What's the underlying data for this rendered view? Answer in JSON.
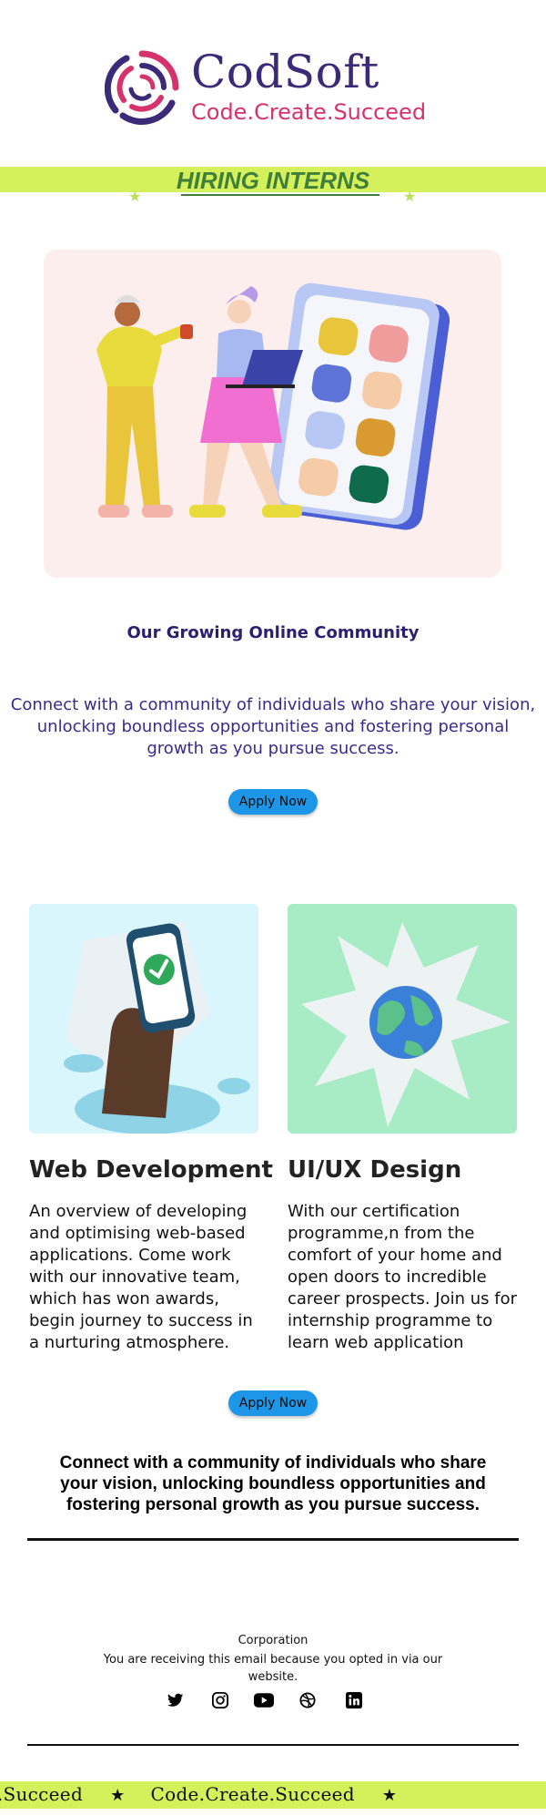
{
  "brand": {
    "name": "CodSoft",
    "tagline": "Code.Create.Succeed",
    "colors": {
      "primary": "#3a2a78",
      "accent": "#d6336c",
      "highlight": "#d4f05a",
      "button": "#1e96e8"
    }
  },
  "hiring": {
    "title": "HIRING INTERNS"
  },
  "hero": {
    "heading": "Our Growing Online Community",
    "text": "Connect with a community of individuals who share your vision, unlocking boundless opportunities and fostering personal growth as you pursue success.",
    "apply_label": "Apply Now"
  },
  "services": [
    {
      "title": "Web Development",
      "description": "An overview of developing and optimising web-based applications.  Come work with our innovative team, which has won awards, begin journey to success in a nurturing atmosphere."
    },
    {
      "title": "UI/UX Design",
      "description": "With our certification programme,n from the comfort of your home and open doors to incredible career prospects. Join us for internship programme to learn web application"
    }
  ],
  "services_apply_label": "Apply Now",
  "statement": "Connect with a community of individuals who share your vision, unlocking boundless opportunities and fostering personal growth as you pursue success.",
  "footer": {
    "corporation": "Corporation",
    "note": "You are receiving this email because you opted in via our website.",
    "social": [
      "twitter-icon",
      "instagram-icon",
      "youtube-icon",
      "dribbble-icon",
      "linkedin-icon"
    ]
  },
  "ticker": {
    "items": [
      "eate.Succeed",
      "Code.Create.Succeed"
    ],
    "separator": "★"
  }
}
